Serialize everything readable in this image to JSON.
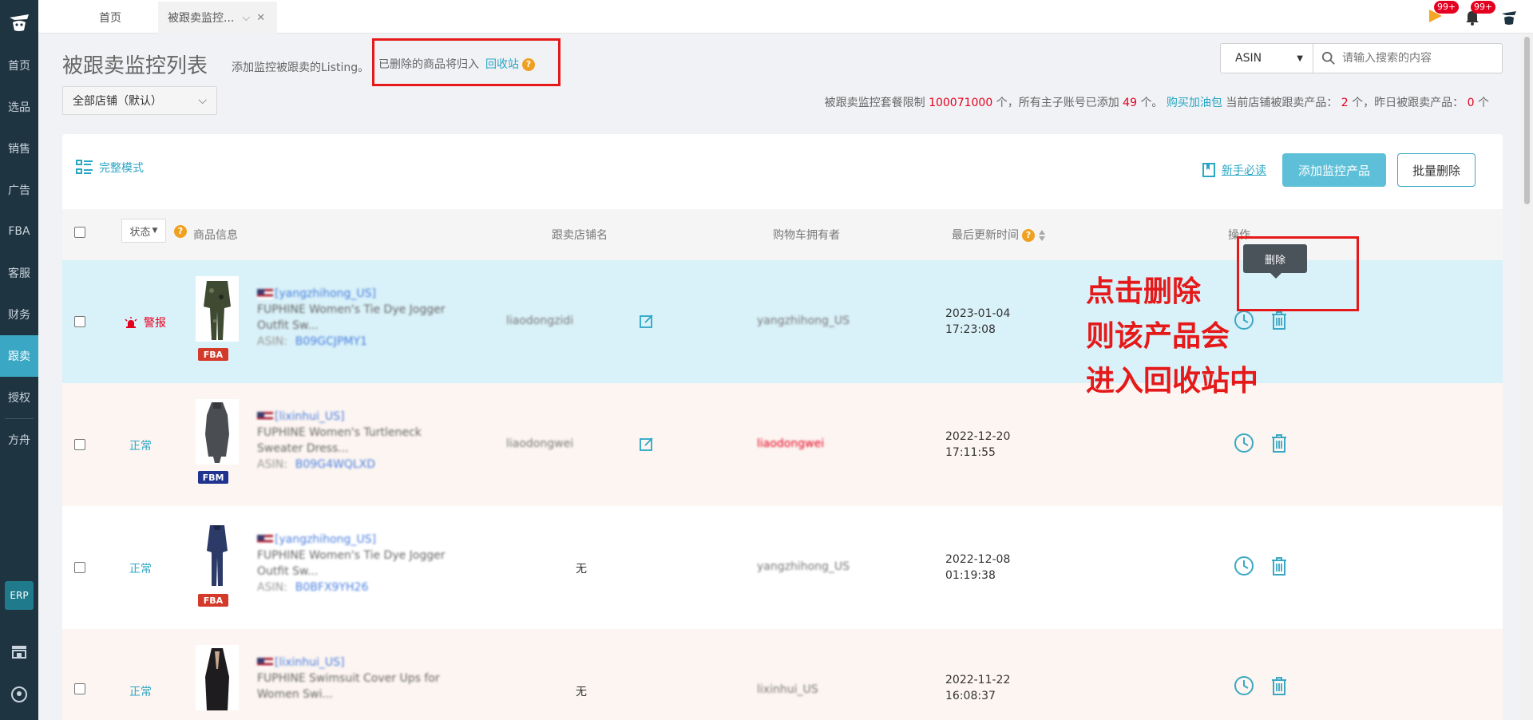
{
  "sidebar": {
    "items": [
      {
        "label": "首页"
      },
      {
        "label": "选品"
      },
      {
        "label": "销售"
      },
      {
        "label": "广告"
      },
      {
        "label": "FBA"
      },
      {
        "label": "客服"
      },
      {
        "label": "财务"
      },
      {
        "label": "跟卖"
      },
      {
        "label": "授权"
      },
      {
        "label": "方舟"
      }
    ],
    "active_index": 7,
    "erp_label": "ERP"
  },
  "topbar": {
    "tabs": [
      {
        "label": "首页"
      },
      {
        "label": "被跟卖监控..."
      }
    ],
    "notification_badge": "99+",
    "bell_badge": "99+"
  },
  "header": {
    "title": "被跟卖监控列表",
    "subtitle": "添加监控被跟卖的Listing。",
    "recycle_text": "已删除的商品将归入",
    "recycle_link": "回收站"
  },
  "search": {
    "type_value": "ASIN",
    "placeholder": "请输入搜索的内容"
  },
  "store_select": {
    "value": "全部店铺（默认）"
  },
  "quota": {
    "p1": "被跟卖监控套餐限制",
    "limit": "100071000",
    "p2": "个，所有主子账号已添加",
    "added": "49",
    "p3": "个。",
    "buy_link": "购买加油包",
    "p4": "当前店铺被跟卖产品：",
    "current": "2",
    "p5": "个，昨日被跟卖产品：",
    "yesterday": "0",
    "p6": "个"
  },
  "card": {
    "mode_label": "完整模式",
    "newbie_label": "新手必读",
    "add_button": "添加监控产品",
    "batch_delete_button": "批量删除"
  },
  "table": {
    "headers": {
      "status": "状态",
      "product": "商品信息",
      "store": "跟卖店铺名",
      "owner": "购物车拥有者",
      "updated": "最后更新时间",
      "actions": "操作"
    },
    "rows": [
      {
        "status": "警报",
        "badge": "FBA",
        "account": "[yangzhihong_US]",
        "title": "FUPHINE Women's Tie Dye Jogger Outfit Sw...",
        "asin_label": "ASIN:",
        "asin": "B09GCJPMY1",
        "store": "liaodongzidi",
        "owner": "yangzhihong_US",
        "date": "2023-01-04",
        "time": "17:23:08"
      },
      {
        "status": "正常",
        "badge": "FBM",
        "account": "[lixinhui_US]",
        "title": "FUPHINE Women's Turtleneck Sweater Dress...",
        "asin_label": "ASIN:",
        "asin": "B09G4WQLXD",
        "store": "liaodongwei",
        "owner": "liaodongwei",
        "date": "2022-12-20",
        "time": "17:11:55"
      },
      {
        "status": "正常",
        "badge": "FBA",
        "account": "[yangzhihong_US]",
        "title": "FUPHINE Women's Tie Dye Jogger Outfit Sw...",
        "asin_label": "ASIN:",
        "asin": "B0BFX9YH26",
        "store": "无",
        "owner": "yangzhihong_US",
        "date": "2022-12-08",
        "time": "01:19:38"
      },
      {
        "status": "正常",
        "badge": "",
        "account": "[lixinhui_US]",
        "title": "FUPHINE Swimsuit Cover Ups for Women Swi...",
        "asin_label": "",
        "asin": "",
        "store": "无",
        "owner": "lixinhui_US",
        "date": "2022-11-22",
        "time": "16:08:37"
      }
    ]
  },
  "tooltip": "删除",
  "annotation": [
    "点击删除",
    "则该产品会",
    "进入回收站中"
  ],
  "colors": {
    "accent": "#2aa6c5",
    "alert": "#e6001f",
    "highlight_box": "#e51919",
    "sidebar": "#1f3441"
  }
}
